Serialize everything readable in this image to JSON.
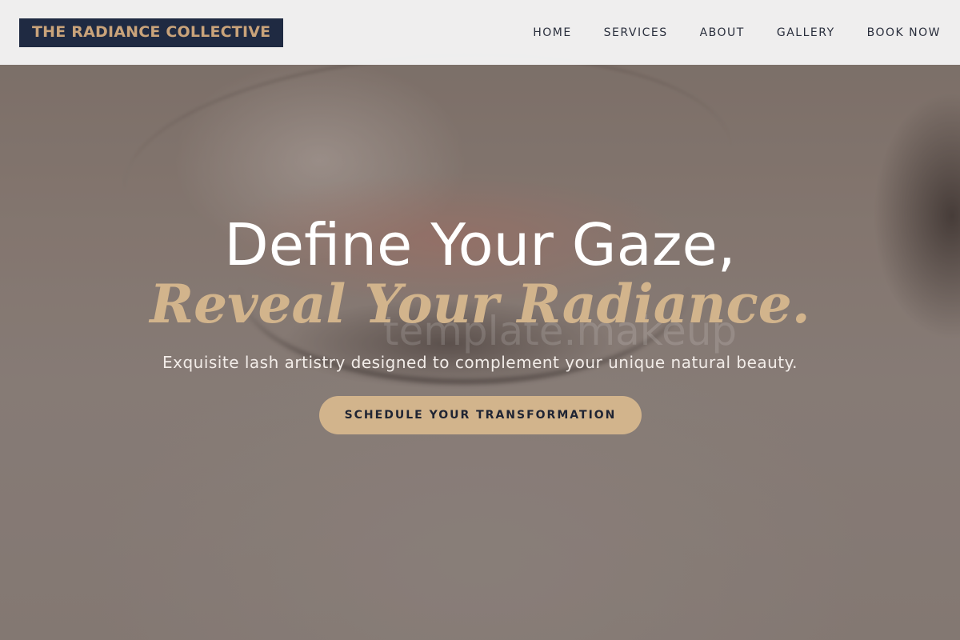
{
  "brand": {
    "name": "THE RADIANCE COLLECTIVE"
  },
  "nav": {
    "items": [
      {
        "label": "HOME"
      },
      {
        "label": "SERVICES"
      },
      {
        "label": "ABOUT"
      },
      {
        "label": "GALLERY"
      },
      {
        "label": "BOOK NOW"
      }
    ]
  },
  "hero": {
    "headline_line1": "Define Your Gaze,",
    "headline_line2": "Reveal Your Radiance.",
    "watermark": "template.makeup",
    "subtitle": "Exquisite lash artistry designed to complement your unique natural beauty.",
    "cta_label": "SCHEDULE YOUR TRANSFORMATION"
  },
  "colors": {
    "brand_navy": "#1f2a42",
    "accent_gold": "#d2b48c",
    "header_bg": "#f4f4f4",
    "nav_text": "#2a2f3d"
  }
}
